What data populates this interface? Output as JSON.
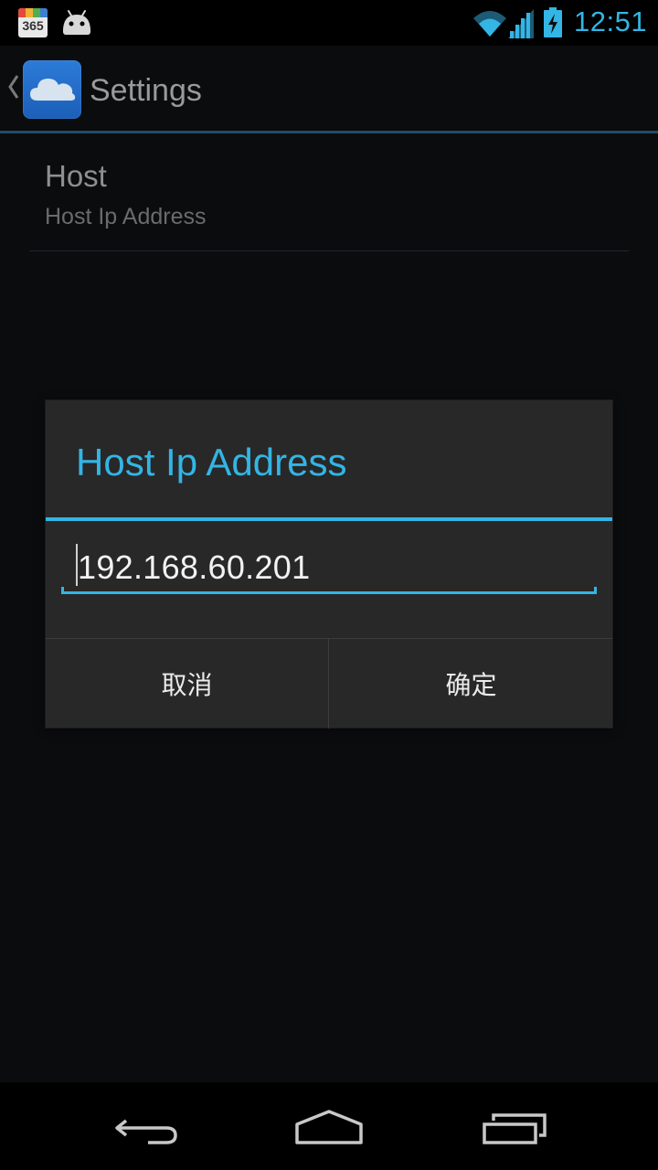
{
  "status_bar": {
    "calendar_icon_text": "365",
    "time": "12:51",
    "icons": [
      "calendar-icon",
      "android-icon",
      "wifi-icon",
      "signal-icon",
      "battery-charging-icon"
    ]
  },
  "action_bar": {
    "title": "Settings",
    "icons": [
      "up-caret-icon",
      "cloud-app-icon"
    ]
  },
  "preferences": [
    {
      "title": "Host",
      "summary": "Host Ip Address"
    }
  ],
  "dialog": {
    "title": "Host Ip Address",
    "input_value": "192.168.60.201",
    "cancel_label": "取消",
    "ok_label": "确定"
  },
  "nav_bar": {
    "icons": [
      "back-icon",
      "home-icon",
      "recents-icon"
    ]
  },
  "colors": {
    "accent": "#33b5e5",
    "background": "#0b0c0e",
    "dialog_background": "#282828",
    "app_icon": "#2c7bd8"
  }
}
